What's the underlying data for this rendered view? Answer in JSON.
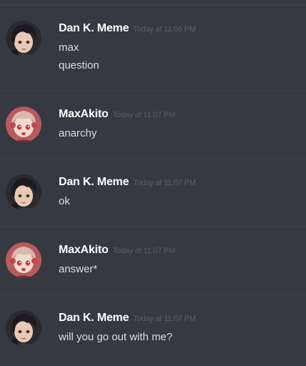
{
  "colors": {
    "background": "#36393f",
    "divider": "#3f4248",
    "username": "#ffffff",
    "timestamp": "#5d6066",
    "message_text": "#dcddde"
  },
  "messages": [
    {
      "author": "Dan K. Meme",
      "timestamp": "Today at 11:06 PM",
      "avatar_icon": "dark-hair-anime-avatar",
      "lines": [
        "max",
        "question"
      ]
    },
    {
      "author": "MaxAkito",
      "timestamp": "Today at 11:07 PM",
      "avatar_icon": "pink-hair-anime-avatar",
      "lines": [
        "anarchy"
      ]
    },
    {
      "author": "Dan K. Meme",
      "timestamp": "Today at 11:07 PM",
      "avatar_icon": "dark-hair-anime-avatar",
      "lines": [
        "ok"
      ]
    },
    {
      "author": "MaxAkito",
      "timestamp": "Today at 11:07 PM",
      "avatar_icon": "pink-hair-anime-avatar",
      "lines": [
        "answer*"
      ]
    },
    {
      "author": "Dan K. Meme",
      "timestamp": "Today at 11:07 PM",
      "avatar_icon": "dark-hair-anime-avatar",
      "lines": [
        "will you go out with me?"
      ]
    }
  ]
}
